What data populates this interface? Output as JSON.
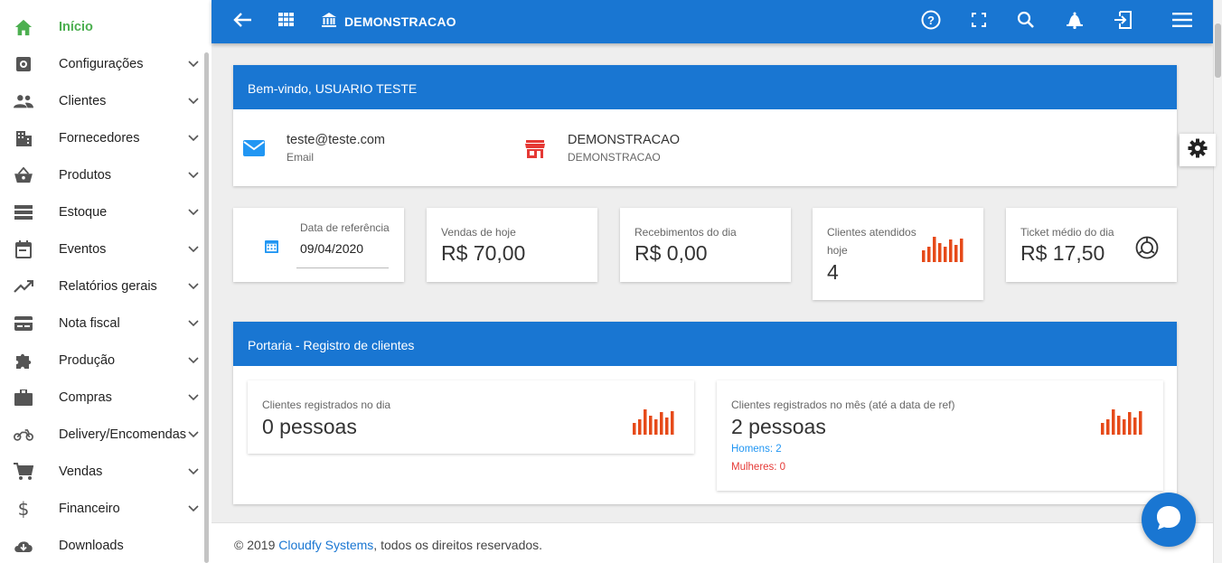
{
  "sidebar": {
    "items": [
      {
        "label": "Início",
        "icon": "home-icon"
      },
      {
        "label": "Configurações",
        "icon": "settings-icon"
      },
      {
        "label": "Clientes",
        "icon": "people-icon"
      },
      {
        "label": "Fornecedores",
        "icon": "building-icon"
      },
      {
        "label": "Produtos",
        "icon": "basket-icon"
      },
      {
        "label": "Estoque",
        "icon": "stack-icon"
      },
      {
        "label": "Eventos",
        "icon": "calendar-icon"
      },
      {
        "label": "Relatórios gerais",
        "icon": "trending-icon"
      },
      {
        "label": "Nota fiscal",
        "icon": "card-icon"
      },
      {
        "label": "Produção",
        "icon": "puzzle-icon"
      },
      {
        "label": "Compras",
        "icon": "briefcase-icon"
      },
      {
        "label": "Delivery/Encomendas",
        "icon": "motorcycle-icon"
      },
      {
        "label": "Vendas",
        "icon": "cart-icon"
      },
      {
        "label": "Financeiro",
        "icon": "dollar-icon"
      },
      {
        "label": "Downloads",
        "icon": "cloud-download-icon"
      }
    ]
  },
  "topbar": {
    "title": "DEMONSTRACAO"
  },
  "welcome": {
    "header": "Bem-vindo, USUARIO TESTE",
    "email_value": "teste@teste.com",
    "email_label": "Email",
    "store_value": "DEMONSTRACAO",
    "store_label": "DEMONSTRACAO"
  },
  "stats": {
    "ref_label": "Data de referência",
    "ref_value": "09/04/2020",
    "sales_label": "Vendas de hoje",
    "sales_value": "R$ 70,00",
    "receipts_label": "Recebimentos do dia",
    "receipts_value": "R$ 0,00",
    "clients_label_1": "Clientes atendidos",
    "clients_label_2": "hoje",
    "clients_value": "4",
    "ticket_label": "Ticket médio do dia",
    "ticket_value": "R$ 17,50"
  },
  "portaria": {
    "header": "Portaria - Registro de clientes",
    "day_label": "Clientes registrados no dia",
    "day_value": "0 pessoas",
    "month_label": "Clientes registrados no mês (até a data de ref)",
    "month_value": "2 pessoas",
    "men": "Homens: 2",
    "women": "Mulheres: 0"
  },
  "footer": {
    "prefix": "© 2019 ",
    "link": "Cloudfy Systems",
    "suffix": ", todos os direitos reservados."
  },
  "colors": {
    "primary": "#1976d2",
    "active_green": "#4caf50",
    "chart_orange": "#e64a19",
    "men_blue": "#2196f3",
    "women_red": "#e53935"
  }
}
